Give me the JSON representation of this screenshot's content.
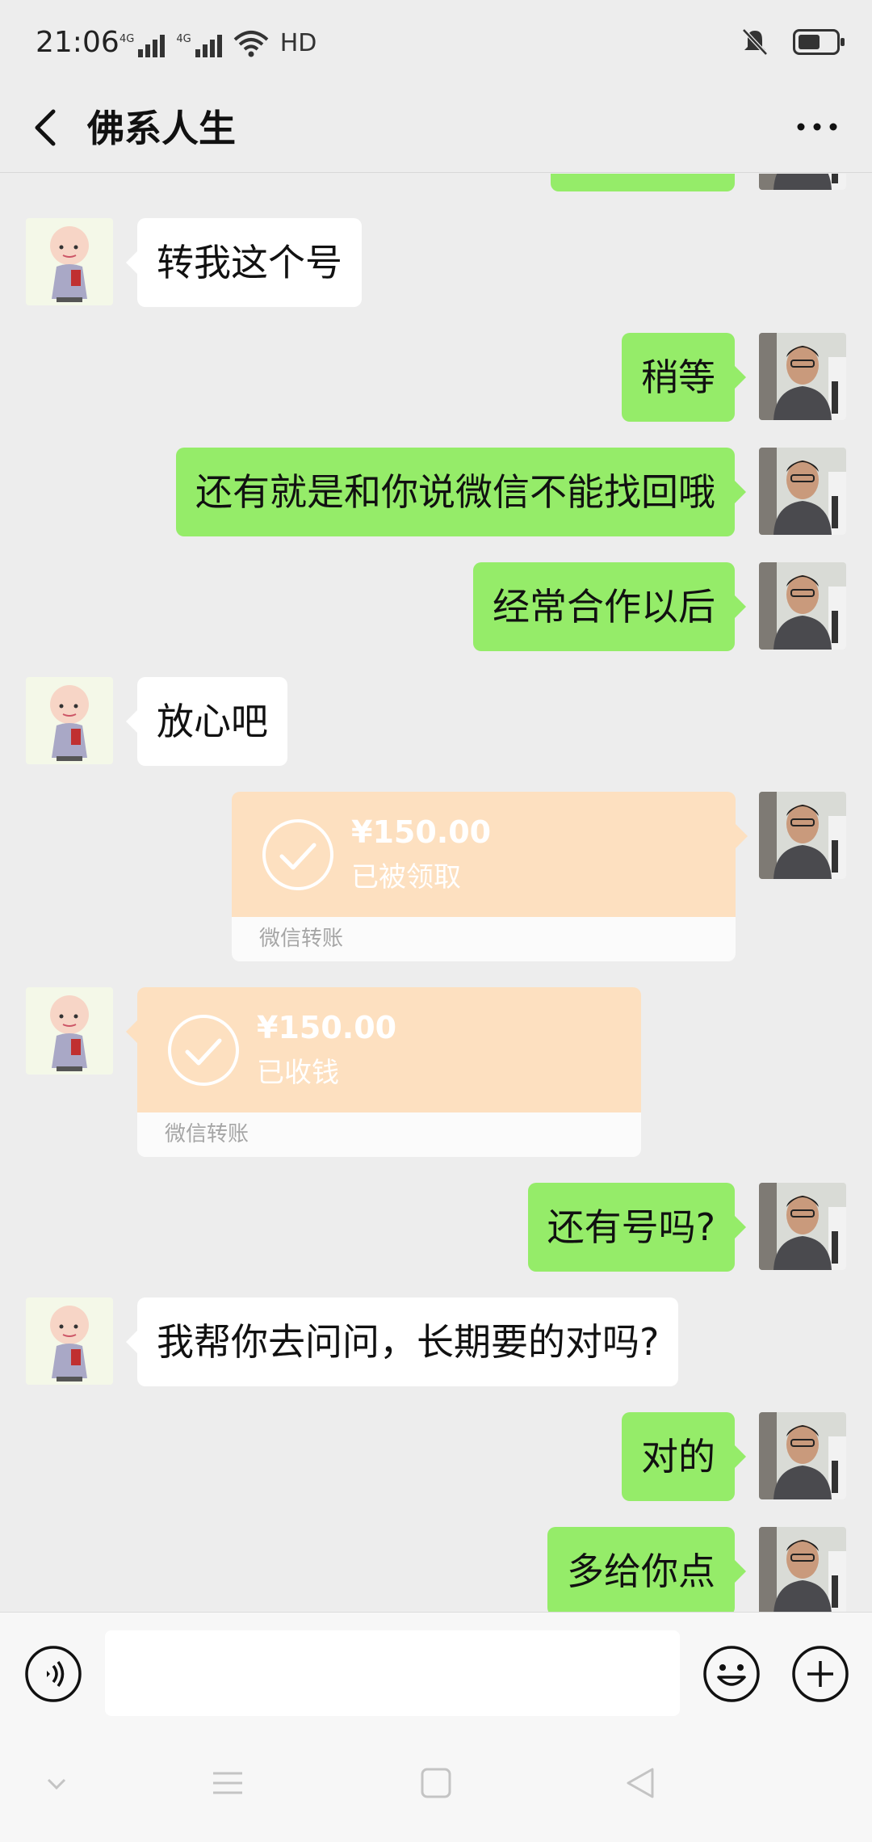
{
  "status_bar": {
    "time": "21:06",
    "signal1_label": "4G",
    "signal2_label": "4G",
    "hd_label": "HD",
    "icons": [
      "signal-icon",
      "signal-icon",
      "wifi-icon",
      "mute-bell-icon",
      "battery-icon"
    ]
  },
  "header": {
    "title": "佛系人生",
    "back_icon": "chevron-left-icon",
    "more_icon": "ellipsis-icon"
  },
  "messages": [
    {
      "sender": "them",
      "text": "转我这个号"
    },
    {
      "sender": "me",
      "text": "稍等"
    },
    {
      "sender": "me",
      "text": "还有就是和你说微信不能找回哦"
    },
    {
      "sender": "me",
      "text": "经常合作以后"
    },
    {
      "sender": "them",
      "text": "放心吧"
    },
    {
      "sender": "me",
      "type": "transfer",
      "amount": "¥150.00",
      "status": "已被领取",
      "footer": "微信转账"
    },
    {
      "sender": "them",
      "type": "transfer",
      "amount": "¥150.00",
      "status": "已收钱",
      "footer": "微信转账"
    },
    {
      "sender": "me",
      "text": "还有号吗?"
    },
    {
      "sender": "them",
      "text": "我帮你去问问，长期要的对吗?"
    },
    {
      "sender": "me",
      "text": "对的"
    },
    {
      "sender": "me",
      "text": "多给你点"
    }
  ],
  "input": {
    "value": "",
    "placeholder": ""
  },
  "colors": {
    "background": "#ededed",
    "my_bubble": "#95ec69",
    "their_bubble": "#ffffff",
    "transfer_card": "#fde0c0"
  }
}
